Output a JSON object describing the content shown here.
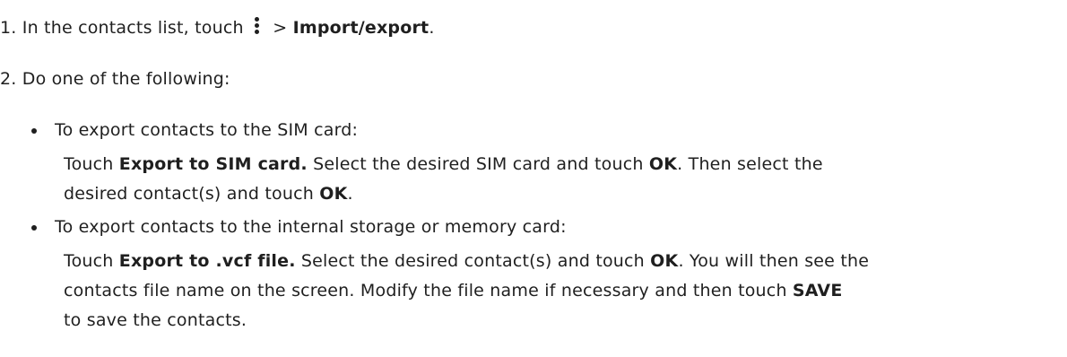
{
  "step1": {
    "prefix": "1. In the contacts list, touch",
    "icon": "more-vert-icon",
    "arrow": " > ",
    "menu_item": "Import/export",
    "end": "."
  },
  "step2": {
    "text": "2. Do one of the following:"
  },
  "option_sim": {
    "heading": "To export contacts to the SIM card:",
    "l1_a": "Touch ",
    "l1_b": "Export to SIM card.",
    "l1_c": " Select the desired SIM card and touch ",
    "l1_d": "OK",
    "l1_e": ". Then select the",
    "l2_a": "desired contact(s) and touch ",
    "l2_b": "OK",
    "l2_c": "."
  },
  "option_vcf": {
    "heading": "To export contacts to the internal storage or memory card:",
    "l1_a": "Touch ",
    "l1_b": "Export to .vcf file.",
    "l1_c": " Select the desired contact(s) and touch ",
    "l1_d": "OK",
    "l1_e": ". You will then see the",
    "l2_a": "contacts file name on the screen. Modify the file name if necessary and then touch ",
    "l2_b": "SAVE",
    "l3": "to save the contacts."
  }
}
